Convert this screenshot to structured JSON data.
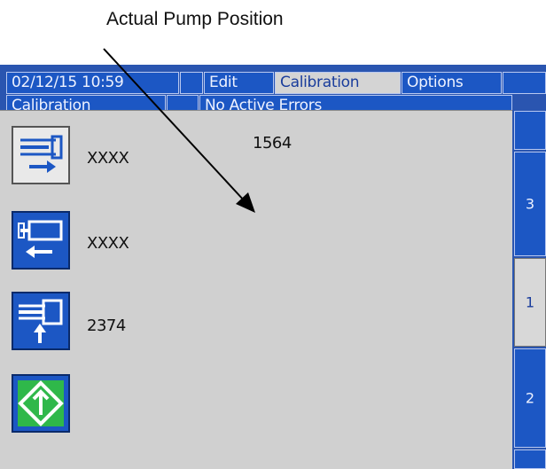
{
  "callout": {
    "label": "Actual Pump Position"
  },
  "header": {
    "datetime": "02/12/15 10:59",
    "tabs": [
      "Edit",
      "Calibration",
      "Options"
    ],
    "screen_name": "Calibration",
    "status": "No Active Errors"
  },
  "main": {
    "reading": "1564",
    "rows": [
      {
        "icon": "pump-extend-icon",
        "value": "XXXX"
      },
      {
        "icon": "pump-retract-icon",
        "value": "XXXX"
      },
      {
        "icon": "pump-raise-icon",
        "value": "2374"
      },
      {
        "icon": "start-diamond-icon"
      }
    ]
  },
  "side_tabs": [
    "3",
    "1",
    "2"
  ],
  "colors": {
    "bar_blue": "#1c57c4",
    "panel_gray": "#d0d0d0",
    "start_green": "#2fb84a"
  }
}
